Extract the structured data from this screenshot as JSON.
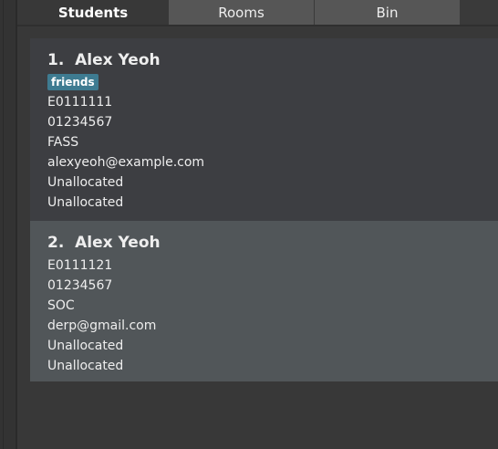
{
  "tabs": [
    "Students",
    "Rooms",
    "Bin"
  ],
  "selected_tab": "Students",
  "students": [
    {
      "index": "1.",
      "name": "Alex Yeoh",
      "tags": [
        "friends"
      ],
      "fields": [
        "E0111111",
        "01234567",
        "FASS",
        "alexyeoh@example.com",
        "Unallocated",
        "Unallocated"
      ]
    },
    {
      "index": "2.",
      "name": "Alex Yeoh",
      "tags": [],
      "fields": [
        "E0111121",
        "01234567",
        "SOC",
        "derp@gmail.com",
        "Unallocated",
        "Unallocated"
      ]
    }
  ],
  "colors": {
    "tag": "#3e7b91",
    "card_selected": "#515659",
    "card": "#3d3e42",
    "tab_inactive": "#565656"
  }
}
